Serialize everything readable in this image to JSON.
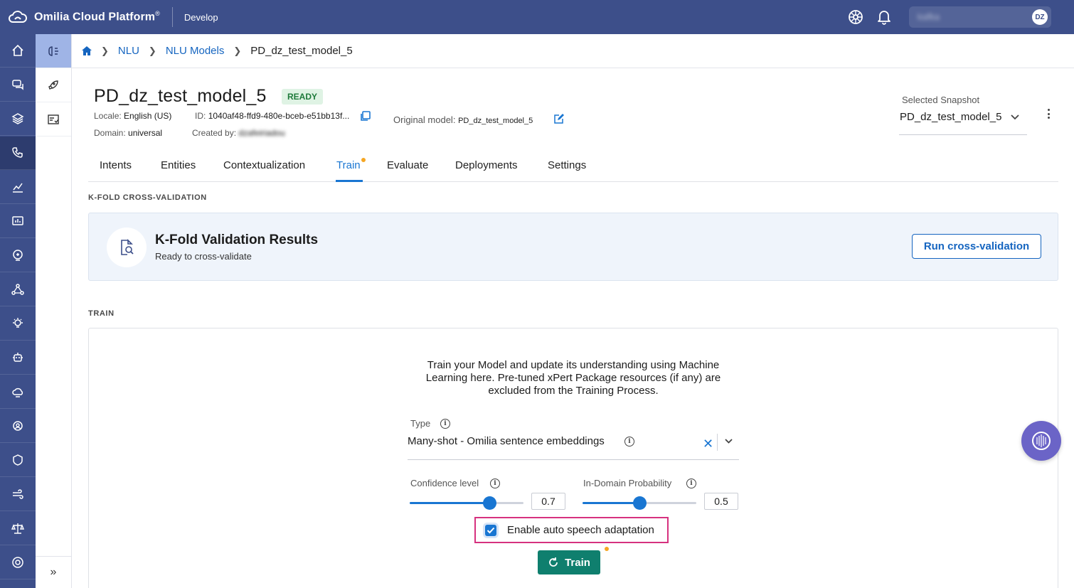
{
  "topbar": {
    "app_name": "Omilia Cloud Platform",
    "registered": "®",
    "environment": "Develop",
    "user_name": "kafka",
    "user_initials": "DZ"
  },
  "rail": {
    "items": [
      "home-icon",
      "chat-bubbles-icon",
      "layers-icon",
      "phone-settings-icon",
      "chart-icon",
      "dashboard-icon",
      "brain-icon",
      "network-icon",
      "lightbulb-icon",
      "robot-icon",
      "cloud-icon",
      "gear-users-icon",
      "shield-icon",
      "wind-icon",
      "scale-icon",
      "support-icon"
    ],
    "active_index": 3
  },
  "subnav": {
    "items": [
      "nlu-brain-icon",
      "rocket-icon",
      "checklist-icon"
    ],
    "active_index": 0,
    "expand_label": "»"
  },
  "breadcrumb": {
    "items": [
      "NLU",
      "NLU Models"
    ],
    "current": "PD_dz_test_model_5"
  },
  "model": {
    "title": "PD_dz_test_model_5",
    "status": "READY",
    "locale_label": "Locale:",
    "locale_value": "English (US)",
    "id_label": "ID:",
    "id_value": "1040af48-ffd9-480e-bceb-e51bb13f...",
    "domain_label": "Domain:",
    "domain_value": "universal",
    "created_label": "Created by:",
    "created_value": "dzafeiriadou",
    "original_label": "Original model:",
    "original_value": "PD_dz_test_model_5"
  },
  "snapshot": {
    "label": "Selected Snapshot",
    "value": "PD_dz_test_model_5"
  },
  "tabs": {
    "items": [
      "Intents",
      "Entities",
      "Contextualization",
      "Train",
      "Evaluate",
      "Deployments",
      "Settings"
    ],
    "active": "Train"
  },
  "kfold": {
    "section_title": "K-FOLD CROSS-VALIDATION",
    "title": "K-Fold Validation Results",
    "subtitle": "Ready to cross-validate",
    "button": "Run cross-validation"
  },
  "train": {
    "section_title": "TRAIN",
    "description": "Train your Model and update its understanding using Machine Learning here. Pre-tuned xPert Package resources (if any) are excluded from the Training Process.",
    "type_label": "Type",
    "type_value": "Many-shot - Omilia sentence embeddings",
    "confidence_label": "Confidence level",
    "confidence_value": "0.7",
    "confidence_fraction": 0.7,
    "indomain_label": "In-Domain Probability",
    "indomain_value": "0.5",
    "indomain_fraction": 0.5,
    "auto_speech_label": "Enable auto speech adaptation",
    "auto_speech_checked": true,
    "button": "Train"
  },
  "colors": {
    "brand": "#3d4f8a",
    "accent": "#1976d2",
    "train_button": "#0f7f6e",
    "highlight": "#d6317f",
    "notification_dot": "#f5a623"
  }
}
